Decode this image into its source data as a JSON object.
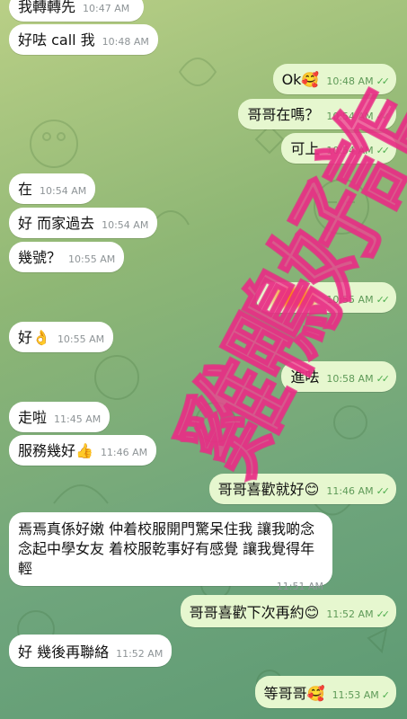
{
  "messages": [
    {
      "side": "in",
      "text": "我轉轉先",
      "time": "10:47 AM"
    },
    {
      "side": "in",
      "text": "好呿 call 我",
      "time": "10:48 AM"
    },
    {
      "side": "out",
      "text": "Ok🥰",
      "time": "10:48 AM"
    },
    {
      "side": "out",
      "text": "哥哥在嗎？",
      "time": "10:54 AM"
    },
    {
      "side": "out",
      "text": "可上",
      "time": "10:54 AM"
    },
    {
      "side": "in",
      "text": "在",
      "time": "10:54 AM"
    },
    {
      "side": "in",
      "text": "好 而家過去",
      "time": "10:54 AM"
    },
    {
      "side": "in",
      "text": "幾號？",
      "time": "10:55 AM"
    },
    {
      "side": "out",
      "text": "",
      "time": "10:55 AM",
      "redacted": true
    },
    {
      "side": "in",
      "text": "好👌",
      "time": "10:55 AM"
    },
    {
      "side": "out",
      "text": "進呿",
      "time": "10:58 AM"
    },
    {
      "side": "in",
      "text": "走啦",
      "time": "11:45 AM"
    },
    {
      "side": "in",
      "text": "服務幾好👍",
      "time": "11:46 AM"
    },
    {
      "side": "out",
      "text": "哥哥喜歡就好😊",
      "time": "11:46 AM"
    },
    {
      "side": "in",
      "text": "焉焉真係好嫩 仲着校服開門驚呆住我  讓我啲念念起中學女友 着校服乾事好有感覺 讓我覺得年輕",
      "time": "11:51 AM"
    },
    {
      "side": "out",
      "text": "哥哥喜歡下次再約😊",
      "time": "11:52 AM"
    },
    {
      "side": "in",
      "text": "好 幾後再聯絡",
      "time": "11:52 AM"
    },
    {
      "side": "out",
      "text": "等哥哥🥰",
      "time": "11:53 AM"
    }
  ],
  "watermark": "雞鴨好詐",
  "colors": {
    "incoming": "#ffffff",
    "outgoing": "#e6f7cf",
    "watermark": "#ee4191"
  }
}
